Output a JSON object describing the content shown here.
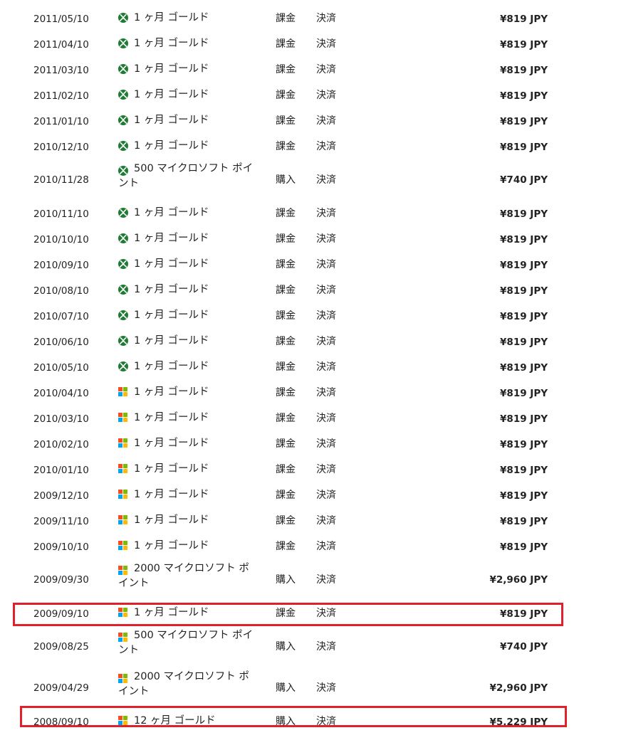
{
  "colors": {
    "xbox_green": "#1f7a33",
    "highlight_red": "#e0202a"
  },
  "transactions": [
    {
      "date": "2011/05/10",
      "icon": "xbox-icon",
      "item": "1 ヶ月 ゴールド",
      "type": "課金",
      "status": "決済",
      "amount": "¥819 JPY"
    },
    {
      "date": "2011/04/10",
      "icon": "xbox-icon",
      "item": "1 ヶ月 ゴールド",
      "type": "課金",
      "status": "決済",
      "amount": "¥819 JPY"
    },
    {
      "date": "2011/03/10",
      "icon": "xbox-icon",
      "item": "1 ヶ月 ゴールド",
      "type": "課金",
      "status": "決済",
      "amount": "¥819 JPY"
    },
    {
      "date": "2011/02/10",
      "icon": "xbox-icon",
      "item": "1 ヶ月 ゴールド",
      "type": "課金",
      "status": "決済",
      "amount": "¥819 JPY"
    },
    {
      "date": "2011/01/10",
      "icon": "xbox-icon",
      "item": "1 ヶ月 ゴールド",
      "type": "課金",
      "status": "決済",
      "amount": "¥819 JPY"
    },
    {
      "date": "2010/12/10",
      "icon": "xbox-icon",
      "item": "1 ヶ月 ゴールド",
      "type": "課金",
      "status": "決済",
      "amount": "¥819 JPY"
    },
    {
      "date": "2010/11/28",
      "icon": "xbox-icon",
      "item": "500 マイクロソフト ポイント",
      "type": "購入",
      "status": "決済",
      "amount": "¥740 JPY",
      "tall": true
    },
    {
      "date": "2010/11/10",
      "icon": "xbox-icon",
      "item": "1 ヶ月 ゴールド",
      "type": "課金",
      "status": "決済",
      "amount": "¥819 JPY"
    },
    {
      "date": "2010/10/10",
      "icon": "xbox-icon",
      "item": "1 ヶ月 ゴールド",
      "type": "課金",
      "status": "決済",
      "amount": "¥819 JPY"
    },
    {
      "date": "2010/09/10",
      "icon": "xbox-icon",
      "item": "1 ヶ月 ゴールド",
      "type": "課金",
      "status": "決済",
      "amount": "¥819 JPY"
    },
    {
      "date": "2010/08/10",
      "icon": "xbox-icon",
      "item": "1 ヶ月 ゴールド",
      "type": "課金",
      "status": "決済",
      "amount": "¥819 JPY"
    },
    {
      "date": "2010/07/10",
      "icon": "xbox-icon",
      "item": "1 ヶ月 ゴールド",
      "type": "課金",
      "status": "決済",
      "amount": "¥819 JPY"
    },
    {
      "date": "2010/06/10",
      "icon": "xbox-icon",
      "item": "1 ヶ月 ゴールド",
      "type": "課金",
      "status": "決済",
      "amount": "¥819 JPY"
    },
    {
      "date": "2010/05/10",
      "icon": "xbox-icon",
      "item": "1 ヶ月 ゴールド",
      "type": "課金",
      "status": "決済",
      "amount": "¥819 JPY"
    },
    {
      "date": "2010/04/10",
      "icon": "windows-icon",
      "item": "1 ヶ月 ゴールド",
      "type": "課金",
      "status": "決済",
      "amount": "¥819 JPY"
    },
    {
      "date": "2010/03/10",
      "icon": "windows-icon",
      "item": "1 ヶ月 ゴールド",
      "type": "課金",
      "status": "決済",
      "amount": "¥819 JPY"
    },
    {
      "date": "2010/02/10",
      "icon": "windows-icon",
      "item": "1 ヶ月 ゴールド",
      "type": "課金",
      "status": "決済",
      "amount": "¥819 JPY"
    },
    {
      "date": "2010/01/10",
      "icon": "windows-icon",
      "item": "1 ヶ月 ゴールド",
      "type": "課金",
      "status": "決済",
      "amount": "¥819 JPY"
    },
    {
      "date": "2009/12/10",
      "icon": "windows-icon",
      "item": "1 ヶ月 ゴールド",
      "type": "課金",
      "status": "決済",
      "amount": "¥819 JPY"
    },
    {
      "date": "2009/11/10",
      "icon": "windows-icon",
      "item": "1 ヶ月 ゴールド",
      "type": "課金",
      "status": "決済",
      "amount": "¥819 JPY"
    },
    {
      "date": "2009/10/10",
      "icon": "windows-icon",
      "item": "1 ヶ月 ゴールド",
      "type": "課金",
      "status": "決済",
      "amount": "¥819 JPY"
    },
    {
      "date": "2009/09/30",
      "icon": "windows-icon",
      "item": "2000 マイクロソフト ポイント",
      "type": "購入",
      "status": "決済",
      "amount": "¥2,960 JPY",
      "tall": true
    },
    {
      "date": "2009/09/10",
      "icon": "windows-icon",
      "item": "1 ヶ月 ゴールド",
      "type": "課金",
      "status": "決済",
      "amount": "¥819 JPY",
      "highlighted": true
    },
    {
      "date": "2009/08/25",
      "icon": "windows-icon",
      "item": "500 マイクロソフト ポイント",
      "type": "購入",
      "status": "決済",
      "amount": "¥740 JPY",
      "tall": true
    },
    {
      "date": "2009/04/29",
      "icon": "windows-icon",
      "item": "2000 マイクロソフト ポイント",
      "type": "購入",
      "status": "決済",
      "amount": "¥2,960 JPY",
      "tall": true
    },
    {
      "date": "2008/09/10",
      "icon": "windows-icon",
      "item": "12 ヶ月 ゴールド",
      "type": "購入",
      "status": "決済",
      "amount": "¥5,229 JPY",
      "highlighted": true
    }
  ]
}
